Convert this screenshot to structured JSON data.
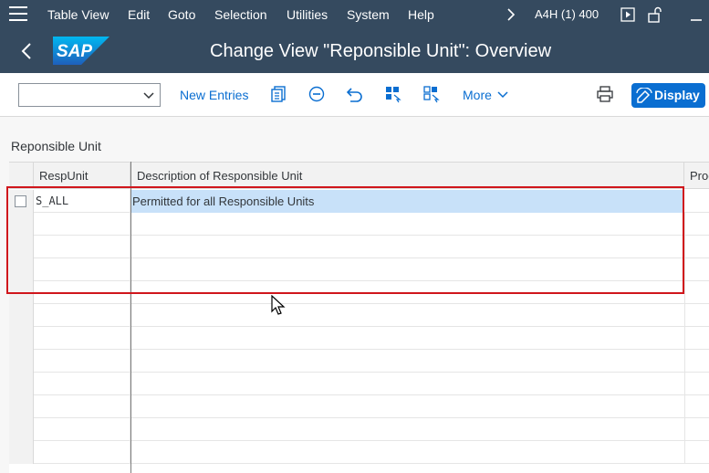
{
  "menubar": {
    "items": [
      "Table View",
      "Edit",
      "Goto",
      "Selection",
      "Utilities",
      "System",
      "Help"
    ],
    "system_info": "A4H (1) 400"
  },
  "titlebar": {
    "logo_text": "SAP",
    "title": "Change View \"Reponsible Unit\": Overview"
  },
  "toolbar": {
    "dropdown_value": "",
    "new_entries": "New Entries",
    "more": "More",
    "display": "Display"
  },
  "section": {
    "title": "Reponsible Unit"
  },
  "table": {
    "columns": [
      "RespUnit",
      "Description of Responsible Unit",
      "Proc"
    ],
    "rows": [
      {
        "resp_unit": "S_ALL",
        "description": "Permitted for all Responsible Units",
        "proc": ""
      }
    ]
  },
  "colors": {
    "shell": "#354a5f",
    "accent": "#0a6ed1",
    "highlight_box": "#d0161c",
    "selected_cell": "#c8e1f9"
  },
  "icons": [
    "menu-icon",
    "chevron-right-icon",
    "play-icon",
    "unlock-icon",
    "minimize-icon",
    "back-icon",
    "sap-logo",
    "copy-icon",
    "delete-icon",
    "undo-icon",
    "select-all-icon",
    "deselect-icon",
    "print-icon",
    "display-icon"
  ]
}
